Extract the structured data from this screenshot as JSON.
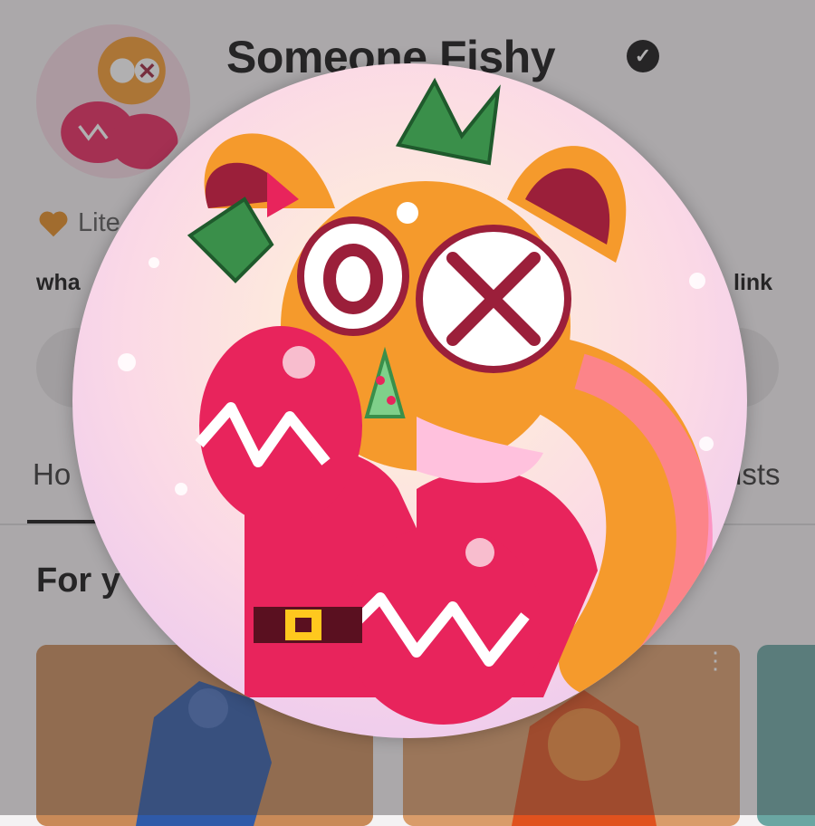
{
  "channel": {
    "name": "Someone Fishy",
    "verified_symbol": "✓",
    "meta_text": "Lite",
    "description": "wha",
    "link_text": "link"
  },
  "tabs": [
    {
      "label": "Ho",
      "active": true
    },
    {
      "label": "ists",
      "active": false
    }
  ],
  "section": {
    "title": "For y"
  },
  "thumbnails": [
    {
      "menu_icon": "⋮"
    },
    {
      "menu_icon": "⋮"
    },
    {
      "menu_icon": ""
    }
  ],
  "icons": {
    "verified": "verified-check-icon",
    "heart": "heart-icon",
    "more": "more-vert-icon"
  },
  "colors": {
    "overlay": "#46424480",
    "accent_pink": "#e8245c",
    "avatar_orange": "#f59a2c",
    "heart_orange": "#e38a1e"
  }
}
